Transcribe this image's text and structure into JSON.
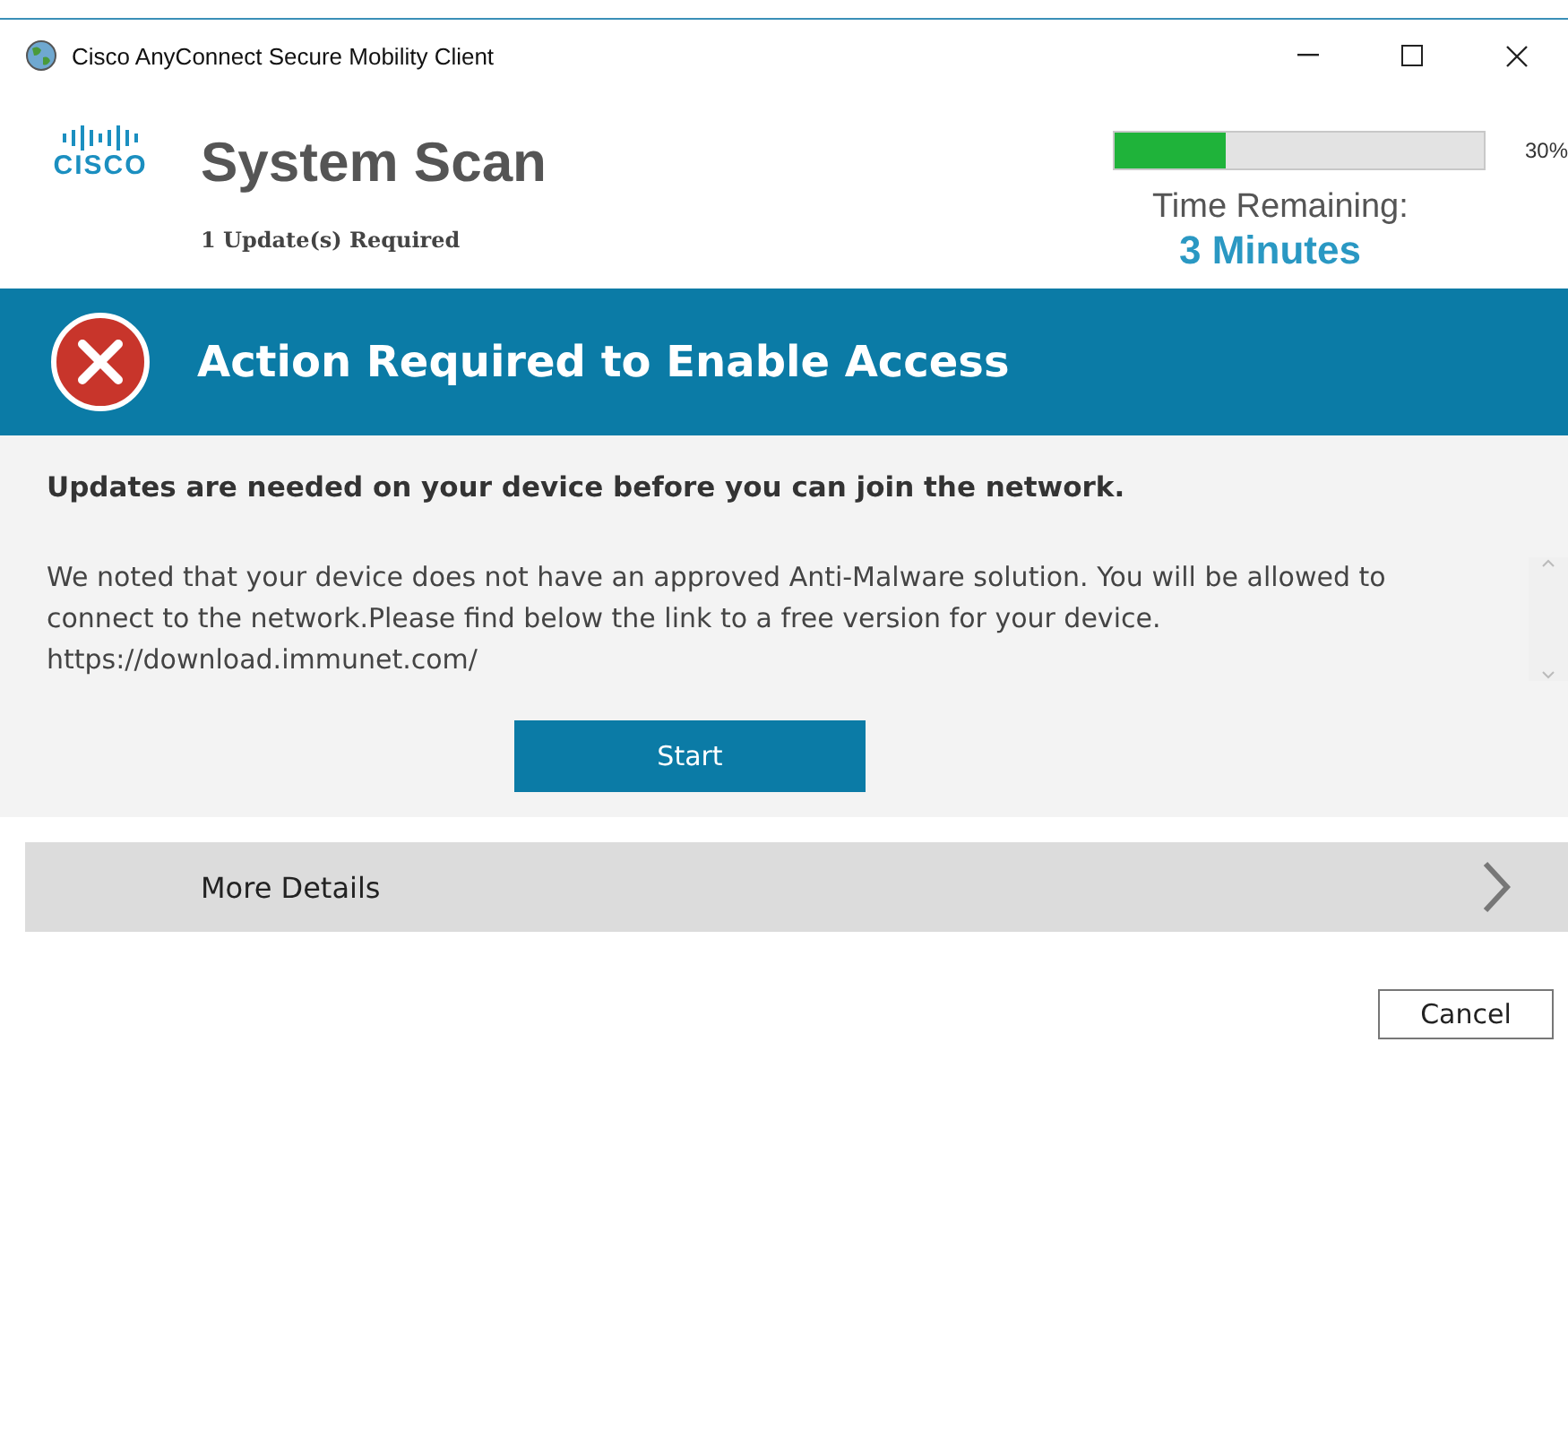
{
  "window": {
    "title": "Cisco AnyConnect Secure Mobility Client"
  },
  "header": {
    "logo_text": "CISCO",
    "title": "System Scan",
    "subtitle": "1 Update(s) Required",
    "progress": {
      "level": 0.3,
      "reading": "30%"
    },
    "time_label": "Time Remaining:",
    "time_value": "3 Minutes"
  },
  "banner": {
    "title": "Action Required to Enable Access"
  },
  "content": {
    "heading": "Updates are needed on your device before you can join the network.",
    "message": "We noted that your device does not have an approved Anti-Malware solution. You will be allowed to connect to the network.Please find below the link to a free version for your device.",
    "link": "https://download.immunet.com/",
    "button": "Start"
  },
  "details": {
    "label": "More Details",
    "expanded": false
  },
  "buttons": [
    "Cancel"
  ]
}
